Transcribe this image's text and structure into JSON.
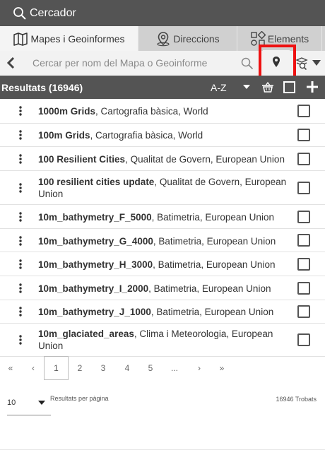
{
  "app": {
    "title": "Cercador"
  },
  "tabs": [
    {
      "label": "Mapes i Geoinformes",
      "icon": "map-icon",
      "active": true
    },
    {
      "label": "Direccions",
      "icon": "place-marker-icon",
      "active": false
    },
    {
      "label": "Elements",
      "icon": "grid-shapes-icon",
      "active": false
    }
  ],
  "search": {
    "placeholder": "Cercar per nom del Mapa o Geoinforme",
    "value": ""
  },
  "results": {
    "title": "Resultats (16946)",
    "sort_label": "A-Z",
    "items": [
      {
        "name": "1000m Grids",
        "meta": ", Cartografia bàsica, World"
      },
      {
        "name": "100m Grids",
        "meta": ", Cartografia bàsica, World"
      },
      {
        "name": "100 Resilient Cities",
        "meta": ", Qualitat de Govern, European Union"
      },
      {
        "name": "100 resilient cities update",
        "meta": ", Qualitat de Govern, European Union"
      },
      {
        "name": "10m_bathymetry_F_5000",
        "meta": ", Batimetria, European Union"
      },
      {
        "name": "10m_bathymetry_G_4000",
        "meta": ", Batimetria, European Union"
      },
      {
        "name": "10m_bathymetry_H_3000",
        "meta": ", Batimetria, European Union"
      },
      {
        "name": "10m_bathymetry_I_2000",
        "meta": ", Batimetria, European Union"
      },
      {
        "name": "10m_bathymetry_J_1000",
        "meta": ", Batimetria, European Union"
      },
      {
        "name": "10m_glaciated_areas",
        "meta": ", Clima i Meteorologia, European Union"
      }
    ]
  },
  "pagination": {
    "first": "«",
    "prev": "‹",
    "pages": [
      "1",
      "2",
      "3",
      "4",
      "5"
    ],
    "current": "1",
    "ellipsis": "...",
    "next": "›",
    "last": "»"
  },
  "per_page": {
    "value": "10",
    "label": "Resultats per pàgina"
  },
  "found": {
    "label": "16946 Trobats"
  },
  "colors": {
    "header_bg": "#545454",
    "tab_bg": "#d0d0d0",
    "highlight": "#ee1111"
  }
}
